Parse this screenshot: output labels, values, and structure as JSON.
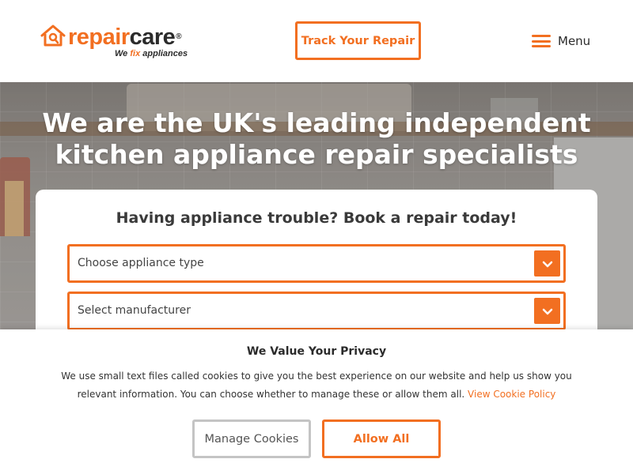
{
  "brand": {
    "name_part1": "repair",
    "name_part2": "care",
    "registered_mark": "®",
    "tagline_pre": "We ",
    "tagline_fix": "fix",
    "tagline_post": " appliances",
    "accent_color": "#f26f21",
    "logo_icon": "house-wrench-icon"
  },
  "header": {
    "track_button_label": "Track Your Repair",
    "menu_label": "Menu",
    "menu_icon": "hamburger-icon"
  },
  "hero": {
    "title": "We are the UK's leading independent kitchen appliance repair specialists"
  },
  "booking": {
    "title": "Having appliance trouble? Book a repair today!",
    "appliance_select_label": "Choose appliance type",
    "manufacturer_select_label": "Select manufacturer",
    "dropdown_icon": "chevron-down-icon"
  },
  "cookie_banner": {
    "title": "We Value Your Privacy",
    "text": "We use small text files called cookies to give you the best experience on our website and help us show you relevant information. You can choose whether to manage these or allow them all.",
    "link_label": "View Cookie Policy",
    "manage_button_label": "Manage Cookies",
    "allow_button_label": "Allow All"
  }
}
